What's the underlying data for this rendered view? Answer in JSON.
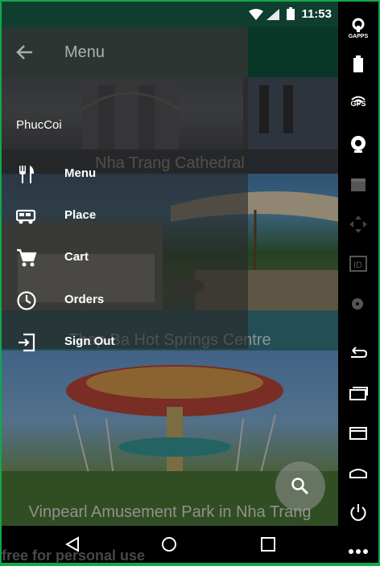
{
  "status_bar": {
    "time": "11:53"
  },
  "drawer": {
    "title": "Menu",
    "username": "PhucCoi",
    "items": [
      {
        "label": "Menu",
        "icon": "restaurant-icon"
      },
      {
        "label": "Place",
        "icon": "bus-icon"
      },
      {
        "label": "Cart",
        "icon": "cart-icon"
      },
      {
        "label": "Orders",
        "icon": "clock-icon"
      },
      {
        "label": "Sign Out",
        "icon": "sign-out-icon"
      }
    ]
  },
  "places": [
    {
      "title": "Nha Trang Cathedral"
    },
    {
      "title": "Thap Ba Hot Springs Centre"
    },
    {
      "title": "Vinpearl Amusement Park in Nha Trang"
    }
  ],
  "fab": {
    "icon": "search-icon"
  },
  "side_panel": [
    {
      "label": "GAPPS",
      "icon": "gapps-icon"
    },
    {
      "label": "",
      "icon": "battery-icon"
    },
    {
      "label": "GPS",
      "icon": "gps-icon"
    },
    {
      "label": "",
      "icon": "camera-icon"
    },
    {
      "label": "",
      "icon": "clapper-icon"
    },
    {
      "label": "",
      "icon": "dpad-icon"
    },
    {
      "label": "",
      "icon": "id-icon"
    },
    {
      "label": "",
      "icon": "disk-icon"
    },
    {
      "label": "",
      "icon": "back-icon"
    },
    {
      "label": "",
      "icon": "recent-apps-icon"
    },
    {
      "label": "",
      "icon": "menu-icon"
    },
    {
      "label": "",
      "icon": "home-icon"
    },
    {
      "label": "",
      "icon": "power-icon"
    },
    {
      "label": "",
      "icon": "more-icon"
    }
  ],
  "watermark": "free for personal use",
  "colors": {
    "status_bar": "#0f3e2f",
    "app_bar": "#0d5a40",
    "frame": "#12a84a"
  }
}
